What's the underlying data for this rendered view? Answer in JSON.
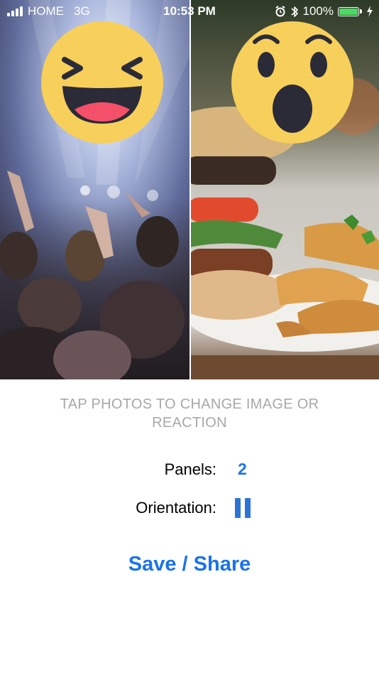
{
  "status_bar": {
    "carrier": "HOME",
    "network": "3G",
    "time": "10:53 PM",
    "battery_percent": "100%",
    "battery_level": 1.0,
    "icons": [
      "signal-icon",
      "alarm-icon",
      "bluetooth-icon",
      "battery-icon",
      "charging-icon"
    ]
  },
  "photos": {
    "count": 2,
    "panels": [
      {
        "scene": "concert crowd",
        "reaction": "haha-emoji-icon"
      },
      {
        "scene": "burger and potato wedges",
        "reaction": "wow-emoji-icon"
      }
    ]
  },
  "hint_text": "TAP PHOTOS TO CHANGE IMAGE OR REACTION",
  "settings": {
    "panels_label": "Panels:",
    "panels_value": "2",
    "orientation_label": "Orientation:",
    "orientation_value_icon": "vertical-split-icon"
  },
  "save_label": "Save / Share",
  "colors": {
    "accent": "#1a73e8",
    "orientation_icon": "#2c73d8",
    "hint": "#a8a8a8",
    "emoji_face": "#f7cf5b",
    "battery": "#4cd964"
  }
}
